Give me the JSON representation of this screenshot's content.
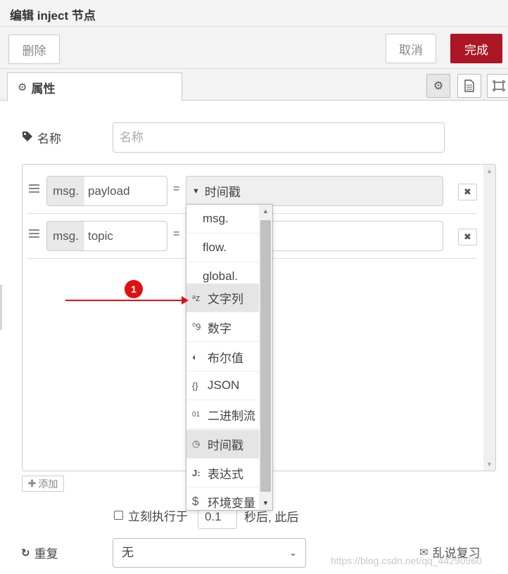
{
  "dialog": {
    "title": "编辑 inject 节点"
  },
  "buttons": {
    "delete": "删除",
    "cancel": "取消",
    "done": "完成"
  },
  "tabs": {
    "properties": "属性"
  },
  "tab_icons": [
    "gear-icon",
    "document-icon",
    "frame-icon"
  ],
  "name": {
    "label": "名称",
    "placeholder": "名称"
  },
  "props": [
    {
      "prefix": "msg.",
      "key": "payload",
      "eq": "=",
      "type_label": "时间戳"
    },
    {
      "prefix": "msg.",
      "key": "topic",
      "eq": "=",
      "type_label": ""
    }
  ],
  "type_menu": [
    {
      "icon": "",
      "label": "msg."
    },
    {
      "icon": "",
      "label": "flow."
    },
    {
      "icon": "",
      "label": "global."
    },
    {
      "icon": "ᵃz",
      "label": "文字列",
      "hovered": true
    },
    {
      "icon": "⁰9",
      "label": "数字"
    },
    {
      "icon": "◐",
      "label": "布尔值"
    },
    {
      "icon": "{}",
      "label": "JSON"
    },
    {
      "icon": "01",
      "label": "二进制流"
    },
    {
      "icon": "◷",
      "label": "时间戳",
      "selected": true
    },
    {
      "icon": "J:",
      "label": "表达式"
    },
    {
      "icon": "$",
      "label": "环境变量"
    }
  ],
  "add_button": "添加",
  "once": {
    "label": "立刻执行于",
    "delay": "0.1",
    "suffix": "秒后, 此后"
  },
  "repeat": {
    "label": "重复",
    "value": "无"
  },
  "annotation": {
    "marker": "1",
    "color": "#e01010"
  },
  "watermark": {
    "brand": "乱说复习",
    "url": "https://blog.csdn.net/qq_44290960"
  },
  "colors": {
    "primary": "#ad1625",
    "menu_hover": "#e5e5e5"
  }
}
